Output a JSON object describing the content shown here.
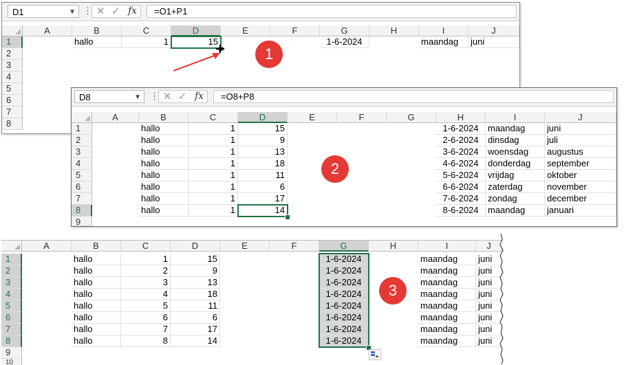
{
  "panel1": {
    "namebox": "D1",
    "formula": "=O1+P1",
    "columns": [
      "A",
      "B",
      "C",
      "D",
      "E",
      "F",
      "G",
      "H",
      "I",
      "J"
    ],
    "rows": [
      "1",
      "2",
      "3",
      "4",
      "5",
      "6",
      "7",
      "8"
    ],
    "cells": {
      "b1": "hallo",
      "c1": "1",
      "d1": "15",
      "g1": "1-6-2024",
      "i1": "maandag",
      "j1": "juni"
    }
  },
  "panel2": {
    "namebox": "D8",
    "formula": "=O8+P8",
    "columns": [
      "A",
      "B",
      "C",
      "D",
      "E",
      "F",
      "G",
      "H",
      "I",
      "J"
    ],
    "rows": [
      "1",
      "2",
      "3",
      "4",
      "5",
      "6",
      "7",
      "8",
      "9"
    ],
    "data": [
      {
        "b": "hallo",
        "c": "1",
        "d": "15",
        "g": "1-6-2024",
        "i": "maandag",
        "j": "juni"
      },
      {
        "b": "hallo",
        "c": "1",
        "d": "9",
        "g": "2-6-2024",
        "i": "dinsdag",
        "j": "juli"
      },
      {
        "b": "hallo",
        "c": "1",
        "d": "13",
        "g": "3-6-2024",
        "i": "woensdag",
        "j": "augustus"
      },
      {
        "b": "hallo",
        "c": "1",
        "d": "18",
        "g": "4-6-2024",
        "i": "donderdag",
        "j": "september"
      },
      {
        "b": "hallo",
        "c": "1",
        "d": "11",
        "g": "5-6-2024",
        "i": "vrijdag",
        "j": "oktober"
      },
      {
        "b": "hallo",
        "c": "1",
        "d": "6",
        "g": "6-6-2024",
        "i": "zaterdag",
        "j": "november"
      },
      {
        "b": "hallo",
        "c": "1",
        "d": "17",
        "g": "7-6-2024",
        "i": "zondag",
        "j": "december"
      },
      {
        "b": "hallo",
        "c": "1",
        "d": "14",
        "g": "8-6-2024",
        "i": "maandag",
        "j": "januari"
      }
    ]
  },
  "panel3": {
    "columns": [
      "A",
      "B",
      "C",
      "D",
      "E",
      "F",
      "G",
      "H",
      "I",
      "J"
    ],
    "rows": [
      "1",
      "2",
      "3",
      "4",
      "5",
      "6",
      "7",
      "8",
      "9",
      "10"
    ],
    "data": [
      {
        "b": "hallo",
        "c": "1",
        "d": "15",
        "g": "1-6-2024",
        "i": "maandag",
        "j": "juni"
      },
      {
        "b": "hallo",
        "c": "2",
        "d": "9",
        "g": "1-6-2024",
        "i": "maandag",
        "j": "juni"
      },
      {
        "b": "hallo",
        "c": "3",
        "d": "13",
        "g": "1-6-2024",
        "i": "maandag",
        "j": "juni"
      },
      {
        "b": "hallo",
        "c": "4",
        "d": "18",
        "g": "1-6-2024",
        "i": "maandag",
        "j": "juni"
      },
      {
        "b": "hallo",
        "c": "5",
        "d": "11",
        "g": "1-6-2024",
        "i": "maandag",
        "j": "juni"
      },
      {
        "b": "hallo",
        "c": "6",
        "d": "6",
        "g": "1-6-2024",
        "i": "maandag",
        "j": "juni"
      },
      {
        "b": "hallo",
        "c": "7",
        "d": "17",
        "g": "1-6-2024",
        "i": "maandag",
        "j": "juni"
      },
      {
        "b": "hallo",
        "c": "8",
        "d": "14",
        "g": "1-6-2024",
        "i": "maandag",
        "j": "juni"
      }
    ]
  },
  "badges": [
    "1",
    "2",
    "3"
  ],
  "colors": {
    "accent": "#217346",
    "badge": "#e53935",
    "arrow": "#e53935"
  }
}
